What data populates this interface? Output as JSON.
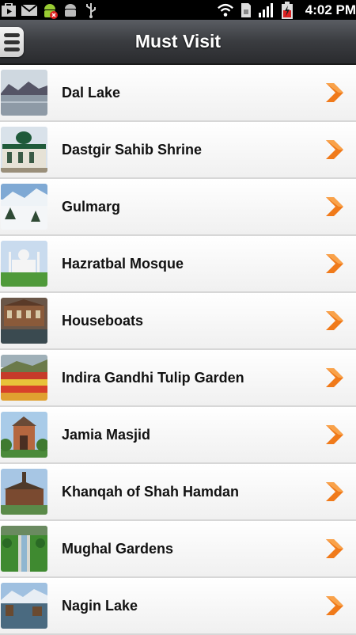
{
  "status_bar": {
    "time": "4:02 PM",
    "icons": [
      "play-store-icon",
      "gmail-icon",
      "android-debug-icon",
      "android-icon",
      "usb-icon",
      "wifi-icon",
      "sim-icon",
      "signal-icon",
      "battery-icon"
    ]
  },
  "header": {
    "title": "Must Visit",
    "menu_icon": "hamburger-icon"
  },
  "colors": {
    "chevron": "#f07a1a",
    "title_bar": "#3a3c40",
    "row_bg": "#f5f5f5"
  },
  "places": [
    {
      "name": "Dal Lake"
    },
    {
      "name": "Dastgir Sahib Shrine"
    },
    {
      "name": "Gulmarg"
    },
    {
      "name": "Hazratbal Mosque"
    },
    {
      "name": "Houseboats"
    },
    {
      "name": "Indira Gandhi Tulip Garden"
    },
    {
      "name": "Jamia Masjid"
    },
    {
      "name": "Khanqah of Shah Hamdan"
    },
    {
      "name": "Mughal Gardens"
    },
    {
      "name": "Nagin Lake"
    }
  ]
}
